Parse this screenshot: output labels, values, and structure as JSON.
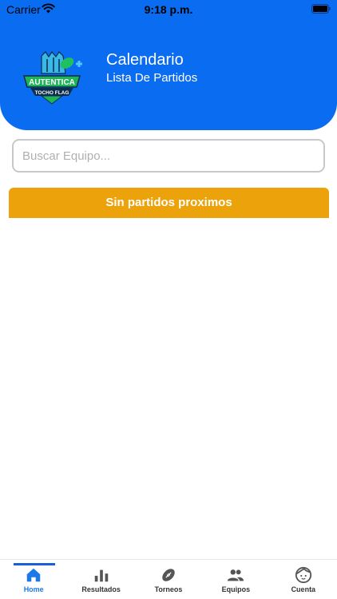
{
  "status_bar": {
    "carrier": "Carrier",
    "time": "9:18 p.m."
  },
  "header": {
    "title": "Calendario",
    "subtitle": "Lista De Partidos",
    "logo_text_main": "AUTENTICA",
    "logo_text_sub": "TOCHO FLAG"
  },
  "search": {
    "placeholder": "Buscar Equipo...",
    "value": ""
  },
  "banner": {
    "text": "Sin partidos proximos"
  },
  "tabs": [
    {
      "label": "Home",
      "icon": "home-icon",
      "active": true
    },
    {
      "label": "Resultados",
      "icon": "bar-chart-icon",
      "active": false
    },
    {
      "label": "Torneos",
      "icon": "football-icon",
      "active": false
    },
    {
      "label": "Equipos",
      "icon": "people-icon",
      "active": false
    },
    {
      "label": "Cuenta",
      "icon": "face-icon",
      "active": false
    }
  ],
  "colors": {
    "header_bg": "#0a6cf1",
    "banner_bg": "#eca20a",
    "tab_active": "#1b7ae8",
    "tab_inactive": "#333333"
  }
}
